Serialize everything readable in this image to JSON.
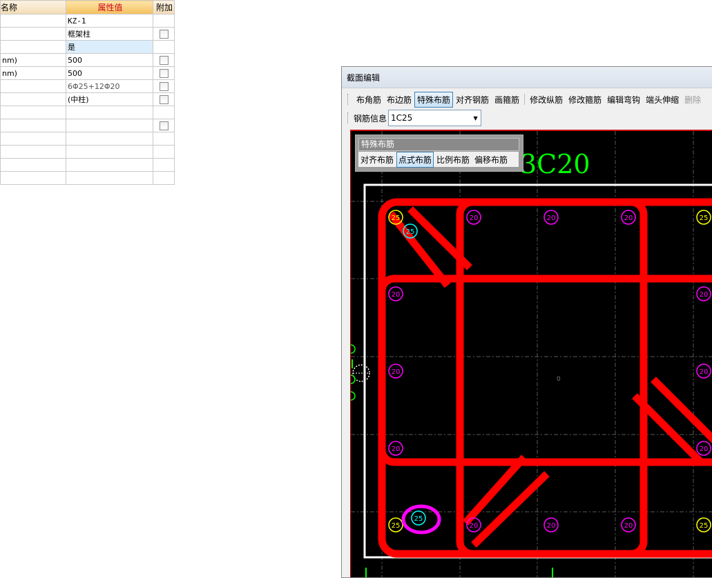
{
  "property_table": {
    "headers": {
      "name": "名称",
      "value": "属性值",
      "extra": "附加"
    },
    "rows": [
      {
        "name": "",
        "value": "KZ-1",
        "check": false,
        "mono": true,
        "selected": false
      },
      {
        "name": "",
        "value": "框架柱",
        "check": true,
        "mono": false,
        "selected": false
      },
      {
        "name": "",
        "value": "是",
        "check": false,
        "mono": false,
        "selected": true
      },
      {
        "name": "nm)",
        "value": "500",
        "check": true,
        "mono": false,
        "selected": false
      },
      {
        "name": "nm)",
        "value": "500",
        "check": true,
        "mono": false,
        "selected": false
      },
      {
        "name": "",
        "value": "6Φ25+12Φ20",
        "check": true,
        "mono": false,
        "selected": false,
        "grey": true
      },
      {
        "name": "",
        "value": "(中柱)",
        "check": true,
        "mono": false,
        "selected": false
      },
      {
        "name": "",
        "value": "",
        "check": false,
        "mono": false,
        "selected": false
      },
      {
        "name": "",
        "value": "",
        "check": true,
        "mono": false,
        "selected": false
      },
      {
        "name": "",
        "value": "",
        "check": false,
        "mono": false,
        "selected": false
      },
      {
        "name": "",
        "value": "",
        "check": false,
        "mono": false,
        "selected": false
      },
      {
        "name": "",
        "value": "",
        "check": false,
        "mono": false,
        "selected": false
      },
      {
        "name": "",
        "value": "",
        "check": false,
        "mono": false,
        "selected": false
      }
    ]
  },
  "window": {
    "title": "截面编辑",
    "toolbar": {
      "buttons": [
        {
          "label": "布角筋",
          "active": false,
          "disabled": false
        },
        {
          "label": "布边筋",
          "active": false,
          "disabled": false
        },
        {
          "label": "特殊布筋",
          "active": true,
          "disabled": false
        },
        {
          "label": "对齐钢筋",
          "active": false,
          "disabled": false
        },
        {
          "label": "画箍筋",
          "active": false,
          "disabled": false,
          "sep_after": true
        },
        {
          "label": "修改纵筋",
          "active": false,
          "disabled": false
        },
        {
          "label": "修改箍筋",
          "active": false,
          "disabled": false
        },
        {
          "label": "编辑弯钩",
          "active": false,
          "disabled": false
        },
        {
          "label": "端头伸缩",
          "active": false,
          "disabled": false
        },
        {
          "label": "删除",
          "active": false,
          "disabled": true
        }
      ]
    },
    "rebar_info": {
      "label": "钢筋信息",
      "value": "1C25"
    },
    "special_panel": {
      "title": "特殊布筋",
      "buttons": [
        {
          "label": "对齐布筋",
          "active": false
        },
        {
          "label": "点式布筋",
          "active": true
        },
        {
          "label": "比例布筋",
          "active": false
        },
        {
          "label": "偏移布筋",
          "active": false
        }
      ]
    },
    "canvas": {
      "edge_label": "3C20",
      "center_label": "0",
      "corner_bar_label": "25",
      "edge_bar_label": "20",
      "added_bar_label": "25",
      "colors": {
        "background": "#000000",
        "stirrup": "#ff0000",
        "corner_bar": "#ffff00",
        "edge_bar": "#ff00ff",
        "added_bar": "#00ffff",
        "label_text": "#00ff00",
        "section_outline": "#ffffff"
      }
    }
  }
}
